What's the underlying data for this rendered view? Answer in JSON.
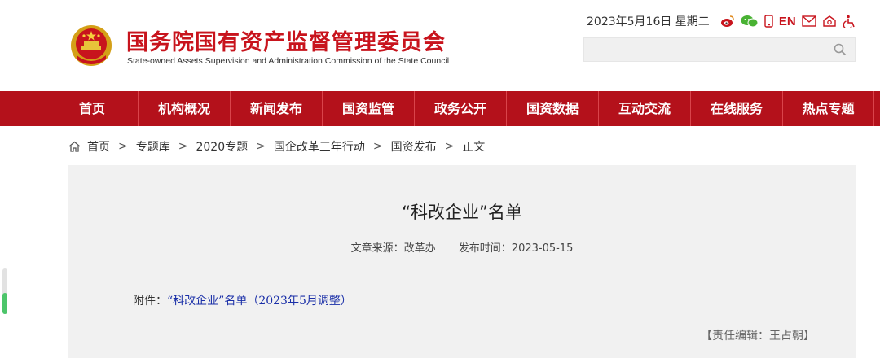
{
  "header": {
    "title_cn": "国务院国有资产监督管理委员会",
    "title_en": "State-owned Assets Supervision and Administration Commission of the State Council",
    "date": "2023年5月16日  星期二",
    "lang_link": "EN",
    "icons": [
      "weibo-icon",
      "wechat-icon",
      "mobile-icon",
      "mail-icon",
      "mailbox-icon",
      "accessibility-icon"
    ],
    "search_placeholder": ""
  },
  "nav": {
    "items": [
      "首页",
      "机构概况",
      "新闻发布",
      "国资监管",
      "政务公开",
      "国资数据",
      "互动交流",
      "在线服务",
      "热点专题"
    ]
  },
  "breadcrumb": {
    "items": [
      "首页",
      "专题库",
      "2020专题",
      "国企改革三年行动",
      "国资发布",
      "正文"
    ],
    "separator": ">"
  },
  "article": {
    "title": "“科改企业”名单",
    "source": "文章来源：改革办",
    "publish_time": "发布时间：2023-05-15",
    "attachment_label": "附件：",
    "attachment_link": "“科改企业”名单（2023年5月调整）",
    "editor": "【责任编辑：王占朝】"
  },
  "scroll": {
    "progress": 0.46
  },
  "colors": {
    "brand_red": "#c8141d",
    "nav_red": "#b4111b",
    "link_blue": "#1a2fa8",
    "panel_bg": "#f1f1f1"
  }
}
